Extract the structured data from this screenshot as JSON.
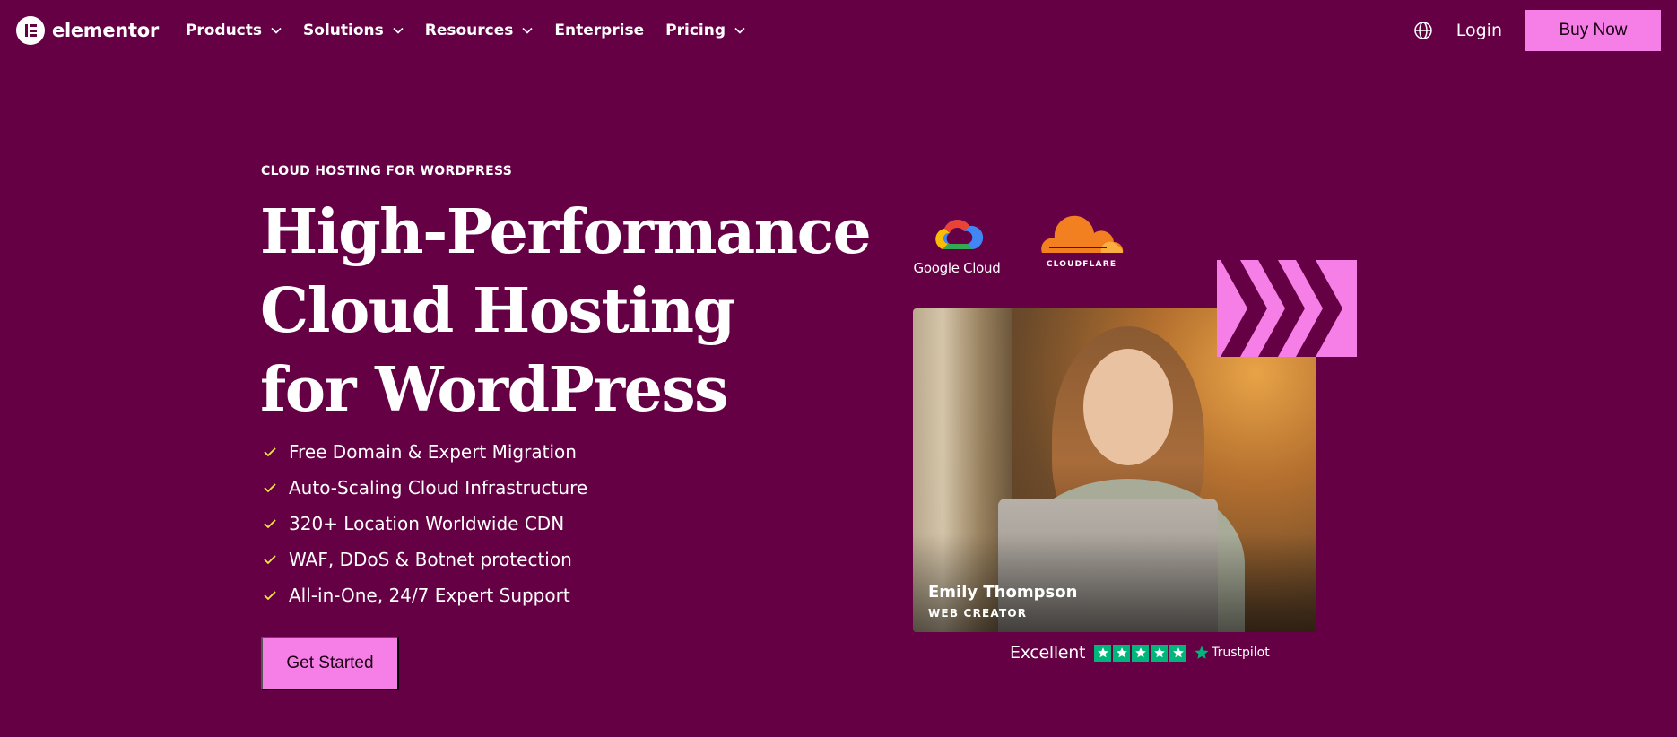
{
  "nav": {
    "logo_text": "elementor",
    "items": [
      {
        "label": "Products",
        "dropdown": true
      },
      {
        "label": "Solutions",
        "dropdown": true
      },
      {
        "label": "Resources",
        "dropdown": true
      },
      {
        "label": "Enterprise",
        "dropdown": false
      },
      {
        "label": "Pricing",
        "dropdown": true
      }
    ],
    "globe_icon": "globe-icon",
    "login_label": "Login",
    "buy_label": "Buy Now"
  },
  "hero": {
    "eyebrow": "CLOUD HOSTING FOR WORDPRESS",
    "headline": [
      "High-Performance",
      "Cloud Hosting",
      "for WordPress"
    ],
    "features": [
      "Free Domain & Expert Migration",
      "Auto-Scaling Cloud Infrastructure",
      "320+ Location Worldwide CDN",
      "WAF, DDoS & Botnet protection",
      "All-in-One, 24/7 Expert Support"
    ],
    "cta_label": "Get Started"
  },
  "partners": {
    "google": "Google Cloud",
    "cloudflare": "CLOUDFLARE"
  },
  "testimonial": {
    "name": "Emily Thompson",
    "role": "WEB CREATOR"
  },
  "trustpilot": {
    "rating_word": "Excellent",
    "stars": 5,
    "brand": "Trustpilot"
  },
  "colors": {
    "background": "#660044",
    "accent_pink": "#f67fe7",
    "check_yellow": "#f0e93e",
    "trustpilot_green": "#00b67a"
  }
}
